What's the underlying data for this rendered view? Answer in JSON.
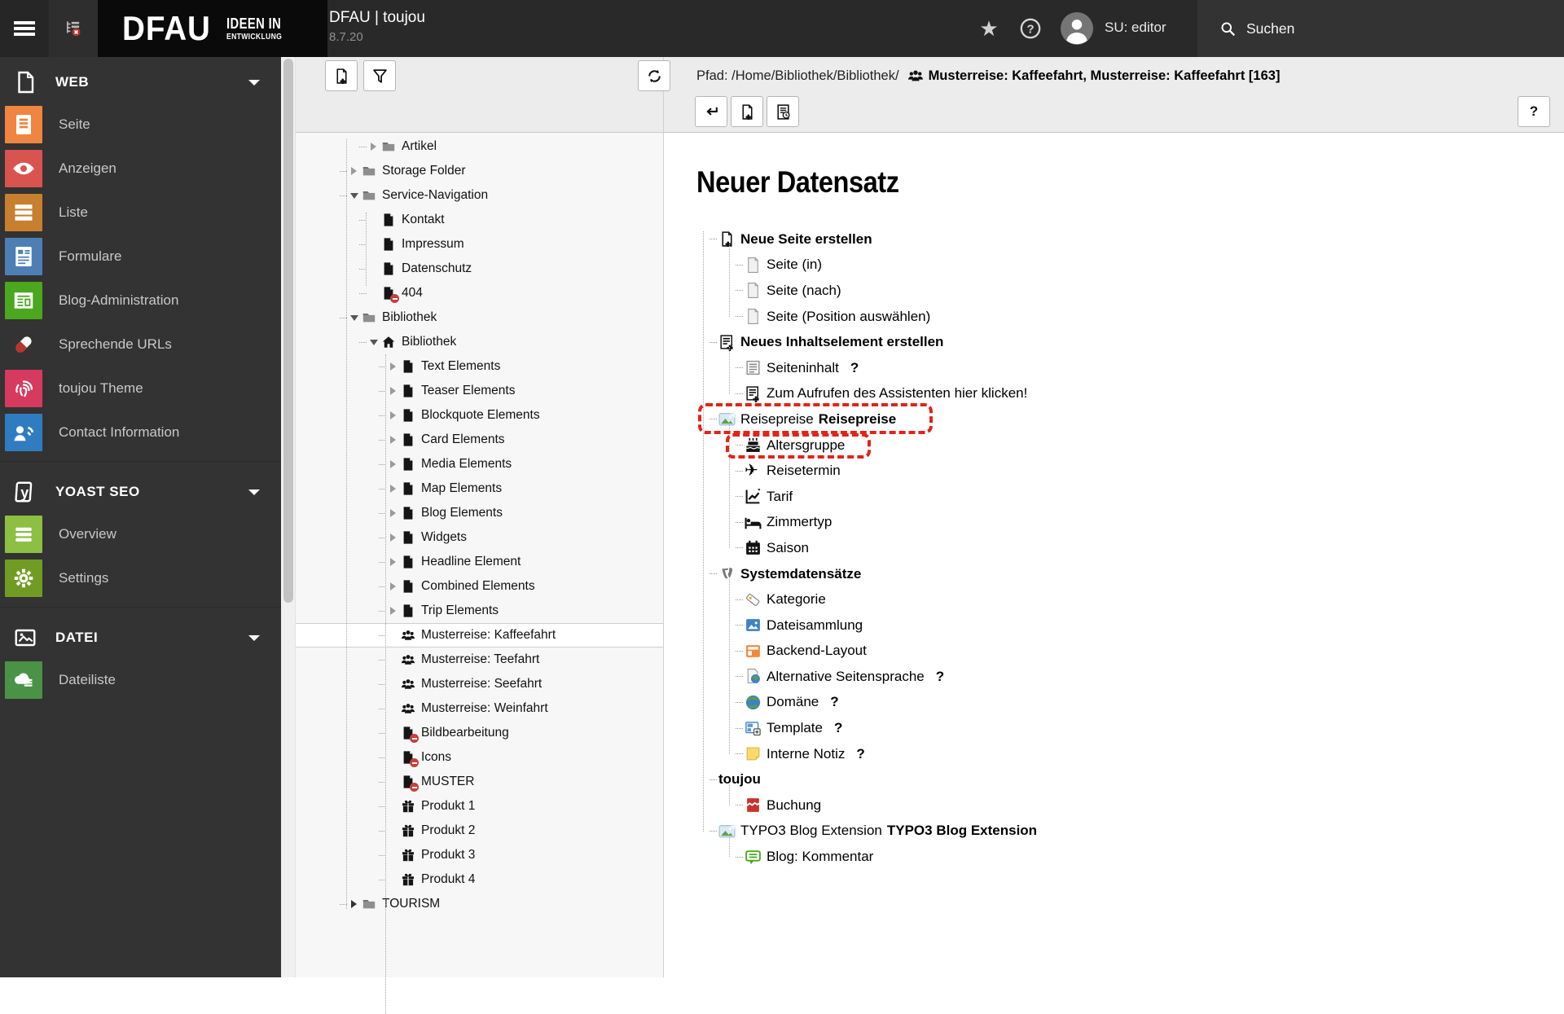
{
  "topbar": {
    "logo_main": "DFAU",
    "logo_sub1": "IDEEN IN",
    "logo_sub2": "ENTWICKLUNG",
    "product": "DFAU | toujou",
    "version": "8.7.20",
    "bookmark_icon": "star-icon",
    "help_icon": "help-circle-icon",
    "user": "SU: editor",
    "search_placeholder": "Suchen"
  },
  "sidebar": {
    "sections": [
      {
        "label": "WEB",
        "icon": "page-outline",
        "items": [
          {
            "label": "Seite",
            "icon": "page-module",
            "tile": "#ef8540"
          },
          {
            "label": "Anzeigen",
            "icon": "eye",
            "tile": "#d9534f"
          },
          {
            "label": "Liste",
            "icon": "list-rows",
            "tile": "#c87f2f"
          },
          {
            "label": "Formulare",
            "icon": "form-doc",
            "tile": "#4d7fb5"
          },
          {
            "label": "Blog-Administration",
            "icon": "news-grid",
            "tile": "#4aa71e"
          },
          {
            "label": "Sprechende URLs",
            "icon": "pill",
            "tile": ""
          },
          {
            "label": "toujou Theme",
            "icon": "fingerprint",
            "tile": "#d63a5f"
          },
          {
            "label": "Contact Information",
            "icon": "contact-person",
            "tile": "#2f7dc0"
          }
        ]
      },
      {
        "label": "YOAST SEO",
        "icon": "yoast-y",
        "items": [
          {
            "label": "Overview",
            "icon": "menu-bars",
            "tile": "#8dbf42"
          },
          {
            "label": "Settings",
            "icon": "gear",
            "tile": "#719c23"
          }
        ]
      },
      {
        "label": "DATEI",
        "icon": "image-outline",
        "items": [
          {
            "label": "Dateiliste",
            "icon": "cloud-list",
            "tile": "#4a9346"
          }
        ]
      }
    ]
  },
  "pagetree": {
    "toolbar": {
      "new_icon": "new-page-icon",
      "filter_icon": "filter-icon",
      "refresh_icon": "refresh-icon"
    },
    "items": [
      {
        "label": "Artikel",
        "icon": "folder",
        "level": 3,
        "arrow": "col"
      },
      {
        "label": "Storage Folder",
        "icon": "folder",
        "level": 2,
        "arrow": "col"
      },
      {
        "label": "Service-Navigation",
        "icon": "folder",
        "level": 2,
        "arrow": "exp"
      },
      {
        "label": "Kontakt",
        "icon": "page-black",
        "level": 3
      },
      {
        "label": "Impressum",
        "icon": "page-black",
        "level": 3
      },
      {
        "label": "Datenschutz",
        "icon": "page-black",
        "level": 3
      },
      {
        "label": "404",
        "icon": "page-black",
        "level": 3,
        "hidden": true
      },
      {
        "label": "Bibliothek",
        "icon": "folder",
        "level": 2,
        "arrow": "exp"
      },
      {
        "label": "Bibliothek",
        "icon": "home",
        "level": 3,
        "arrow": "exp"
      },
      {
        "label": "Text Elements",
        "icon": "page-black",
        "level": 4,
        "arrow": "col"
      },
      {
        "label": "Teaser Elements",
        "icon": "page-black",
        "level": 4,
        "arrow": "col"
      },
      {
        "label": "Blockquote Elements",
        "icon": "page-black",
        "level": 4,
        "arrow": "col"
      },
      {
        "label": "Card Elements",
        "icon": "page-black",
        "level": 4,
        "arrow": "col"
      },
      {
        "label": "Media Elements",
        "icon": "page-black",
        "level": 4,
        "arrow": "col"
      },
      {
        "label": "Map Elements",
        "icon": "page-black",
        "level": 4,
        "arrow": "col"
      },
      {
        "label": "Blog Elements",
        "icon": "page-black",
        "level": 4,
        "arrow": "col"
      },
      {
        "label": "Widgets",
        "icon": "page-black",
        "level": 4,
        "arrow": "col"
      },
      {
        "label": "Headline Element",
        "icon": "page-black",
        "level": 4,
        "arrow": "col"
      },
      {
        "label": "Combined Elements",
        "icon": "page-black",
        "level": 4,
        "arrow": "col"
      },
      {
        "label": "Trip Elements",
        "icon": "page-black",
        "level": 4,
        "arrow": "col"
      },
      {
        "label": "Musterreise: Kaffeefahrt",
        "icon": "users",
        "level": 4,
        "selected": true
      },
      {
        "label": "Musterreise: Teefahrt",
        "icon": "users",
        "level": 4
      },
      {
        "label": "Musterreise: Seefahrt",
        "icon": "users",
        "level": 4
      },
      {
        "label": "Musterreise: Weinfahrt",
        "icon": "users",
        "level": 4
      },
      {
        "label": "Bildbearbeitung",
        "icon": "page-black",
        "level": 4,
        "hidden": true
      },
      {
        "label": "Icons",
        "icon": "page-black",
        "level": 4,
        "hidden": true
      },
      {
        "label": "MUSTER",
        "icon": "page-black",
        "level": 4,
        "hidden": true
      },
      {
        "label": "Produkt 1",
        "icon": "gift",
        "level": 4
      },
      {
        "label": "Produkt 2",
        "icon": "gift",
        "level": 4
      },
      {
        "label": "Produkt 3",
        "icon": "gift",
        "level": 4
      },
      {
        "label": "Produkt 4",
        "icon": "gift",
        "level": 4
      },
      {
        "label": "TOURISM",
        "icon": "folder",
        "level": 2,
        "arrow": "colDark"
      }
    ]
  },
  "content": {
    "path_label": "Pfad:",
    "path": "/Home/Bibliothek/Bibliothek/",
    "path_icon": "users-icon",
    "record_title": "Musterreise: Kaffeefahrt, Musterreise: Kaffeefahrt [163]",
    "toolbar": {
      "back_icon": "back-arrow-icon",
      "new_icon": "new-record-icon",
      "view_icon": "view-record-icon"
    },
    "help_button": "?",
    "help_mark": "?",
    "title": "Neuer Datensatz",
    "tree": [
      {
        "level": 0,
        "bold": true,
        "icon": "page-new",
        "label": "Neue Seite erstellen"
      },
      {
        "level": 1,
        "bold": false,
        "icon": "page-light",
        "label": "Seite (in)"
      },
      {
        "level": 1,
        "bold": false,
        "icon": "page-light",
        "label": "Seite (nach)"
      },
      {
        "level": 1,
        "bold": false,
        "icon": "page-light",
        "label": "Seite (Position auswählen)"
      },
      {
        "level": 0,
        "bold": true,
        "icon": "content-new",
        "label": "Neues Inhaltselement erstellen"
      },
      {
        "level": 1,
        "bold": false,
        "icon": "content",
        "label": "Seiteninhalt",
        "help": true
      },
      {
        "level": 1,
        "bold": false,
        "icon": "content-new",
        "label": "Zum Aufrufen des Assistenten hier klicken!"
      },
      {
        "level": 0,
        "bold": true,
        "icon": "broken-image",
        "pre": "Reisepreise",
        "label": "Reisepreise",
        "dashed": 1
      },
      {
        "level": 1,
        "bold": false,
        "icon": "cake",
        "label": "Altersgruppe",
        "dashed": 2
      },
      {
        "level": 1,
        "bold": false,
        "icon": "plane",
        "label": "Reisetermin"
      },
      {
        "level": 1,
        "bold": false,
        "icon": "chart",
        "label": "Tarif"
      },
      {
        "level": 1,
        "bold": false,
        "icon": "bed",
        "label": "Zimmertyp"
      },
      {
        "level": 1,
        "bold": false,
        "icon": "calendar",
        "label": "Saison"
      },
      {
        "level": 0,
        "bold": true,
        "icon": "typo3",
        "label": "Systemdatensätze"
      },
      {
        "level": 1,
        "bold": false,
        "icon": "tag",
        "label": "Kategorie"
      },
      {
        "level": 1,
        "bold": false,
        "icon": "collection",
        "label": "Dateisammlung"
      },
      {
        "level": 1,
        "bold": false,
        "icon": "backend-layout",
        "label": "Backend-Layout"
      },
      {
        "level": 1,
        "bold": false,
        "icon": "page-globe",
        "label": "Alternative Seitensprache",
        "help": true
      },
      {
        "level": 1,
        "bold": false,
        "icon": "globe",
        "label": "Domäne",
        "help": true
      },
      {
        "level": 1,
        "bold": false,
        "icon": "template",
        "label": "Template",
        "help": true
      },
      {
        "level": 1,
        "bold": false,
        "icon": "note",
        "label": "Interne Notiz",
        "help": true
      },
      {
        "level": 0,
        "bold": true,
        "icon": "",
        "label": "toujou"
      },
      {
        "level": 1,
        "bold": false,
        "icon": "red-doc",
        "label": "Buchung"
      },
      {
        "level": 0,
        "bold": true,
        "icon": "broken-image",
        "pre": "TYPO3 Blog Extension",
        "label": "TYPO3 Blog Extension"
      },
      {
        "level": 1,
        "bold": false,
        "icon": "comment",
        "label": "Blog: Kommentar"
      }
    ]
  }
}
